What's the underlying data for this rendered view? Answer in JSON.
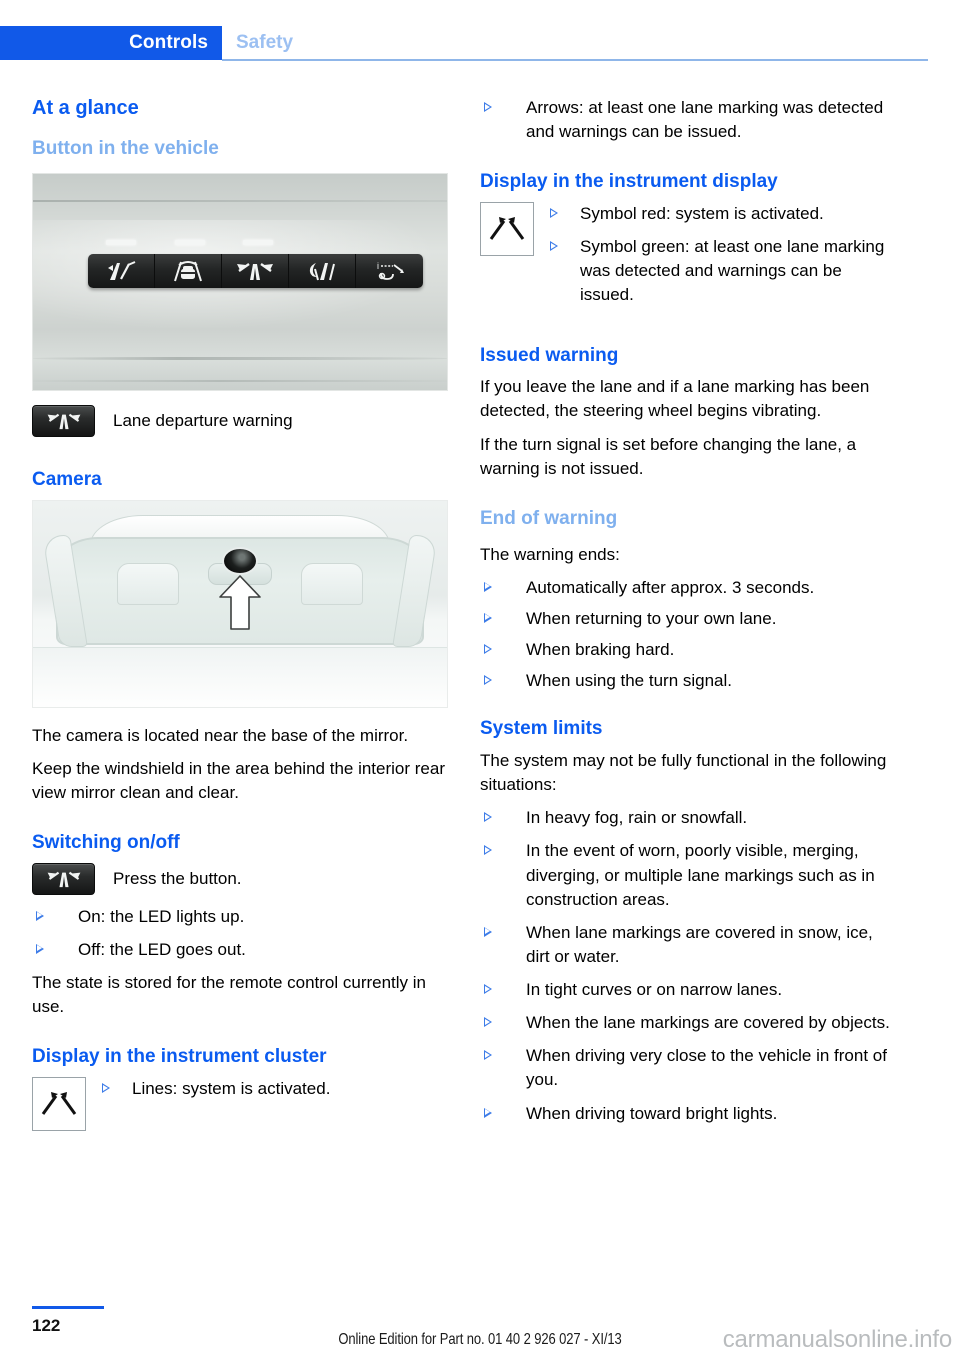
{
  "header": {
    "active_tab": "Controls",
    "inactive_tab": "Safety",
    "active_tab_color": "#1159e8",
    "inactive_tab_color": "#9cc0f2"
  },
  "left_column": {
    "title": "At a glance",
    "section_button": {
      "heading": "Button in the vehicle",
      "figure_name": "dashboard button panel photo",
      "buttons": [
        "lane-change-warning-button",
        "active-cruise-control-button",
        "lane-departure-warning-button",
        "night-vision-button",
        "head-up-display-button"
      ],
      "caption_icon": "lane-departure-warning-icon",
      "caption": "Lane departure warning"
    },
    "section_camera": {
      "heading": "Camera",
      "figure_name": "windshield interior camera location photo",
      "paragraphs": [
        "The camera is located near the base of the mirror.",
        "Keep the windshield in the area behind the interior rear view mirror clean and clear."
      ]
    },
    "section_switching": {
      "heading": "Switching on/off",
      "icon": "lane-departure-warning-button-icon",
      "icon_label": "Press the button.",
      "bullets": [
        "On: the LED lights up.",
        "Off: the LED goes out."
      ],
      "paragraph": "The state is stored for the remote control currently in use."
    },
    "section_cluster": {
      "heading": "Display in the instrument cluster",
      "icon": "lane-departure-lines-symbol",
      "bullets": [
        "Lines: system is activated."
      ]
    }
  },
  "right_column": {
    "top_bullets": [
      "Arrows: at least one lane marking was detected and warnings can be issued."
    ],
    "section_display": {
      "heading": "Display in the instrument display",
      "icon": "lane-departure-arrows-symbol",
      "bullets": [
        "Symbol red: system is activated.",
        "Symbol green: at least one lane marking was detected and warnings can be issued."
      ]
    },
    "section_issued": {
      "heading": "Issued warning",
      "paragraphs": [
        "If you leave the lane and if a lane marking has been detected, the steering wheel begins vibrating.",
        "If the turn signal is set before changing the lane, a warning is not issued."
      ]
    },
    "section_end": {
      "heading": "End of warning",
      "intro": "The warning ends:",
      "bullets": [
        "Automatically after approx. 3 seconds.",
        "When returning to your own lane.",
        "When braking hard.",
        "When using the turn signal."
      ]
    },
    "section_limits": {
      "heading": "System limits",
      "intro": "The system may not be fully functional in the following situations:",
      "bullets": [
        "In heavy fog, rain or snowfall.",
        "In the event of worn, poorly visible, merging, diverging, or multiple lane markings such as in construction areas.",
        "When lane markings are covered in snow, ice, dirt or water.",
        "In tight curves or on narrow lanes.",
        "When the lane markings are covered by objects.",
        "When driving very close to the vehicle in front of you.",
        "When driving toward bright lights."
      ]
    }
  },
  "footer": {
    "page_number": "122",
    "edition": "Online Edition for Part no. 01 40 2 926 027 - XI/13",
    "watermark": "carmanualsonline.info"
  }
}
